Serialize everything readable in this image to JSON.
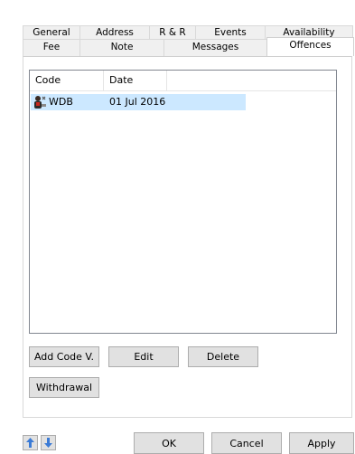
{
  "tabs": {
    "row1": [
      "General",
      "Address",
      "R & R",
      "Events",
      "Availability"
    ],
    "row2": [
      "Fee",
      "Note",
      "Messages",
      "Offences"
    ],
    "active": "Offences"
  },
  "list": {
    "columns": [
      "Code",
      "Date"
    ],
    "rows": [
      {
        "code": "WDB",
        "date": "01 Jul 2016",
        "icon": "offender-icon",
        "selected": true
      }
    ]
  },
  "buttons": {
    "add_code": "Add Code V.",
    "edit": "Edit",
    "delete": "Delete",
    "withdrawal": "Withdrawal"
  },
  "footer": {
    "up_icon": "arrow-up-icon",
    "down_icon": "arrow-down-icon",
    "ok": "OK",
    "cancel": "Cancel",
    "apply": "Apply"
  },
  "colors": {
    "selection": "#cce8ff",
    "arrow": "#3b7bd6"
  }
}
